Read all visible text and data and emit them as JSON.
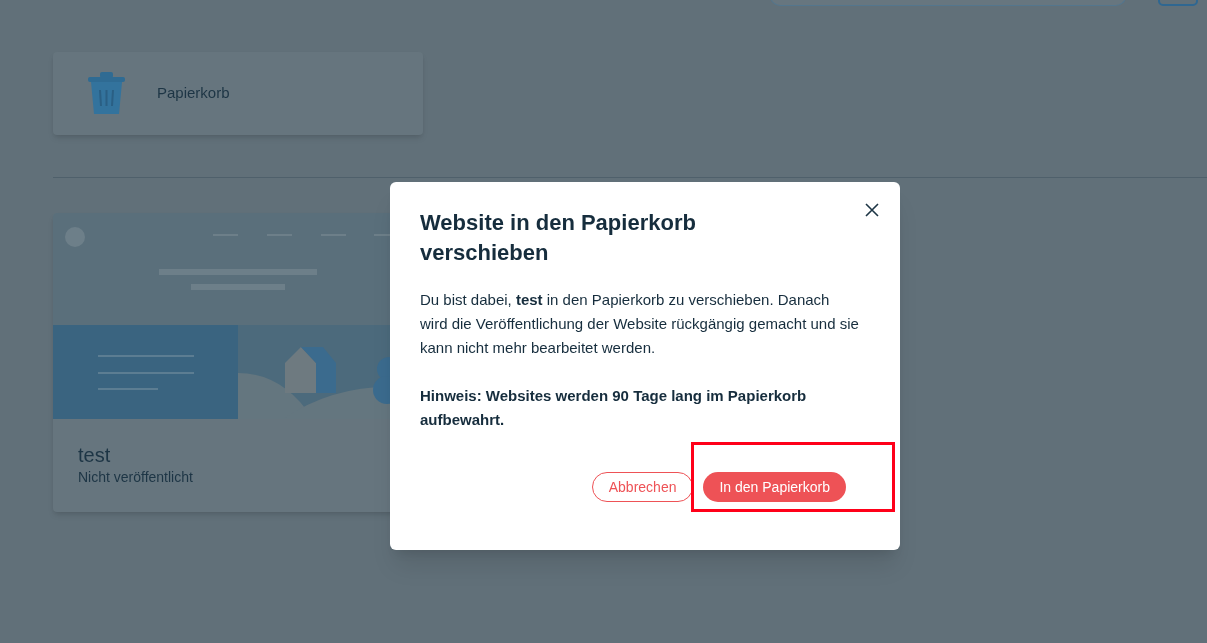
{
  "trash_card": {
    "label": "Papierkorb"
  },
  "site_card": {
    "name": "test",
    "status": "Nicht veröffentlicht"
  },
  "dialog": {
    "title": "Website in den Papierkorb verschieben",
    "message": "Du bist dabei, **test** in den Papierkorb zu verschieben. Danach wird die Veröffentlichung der Website rückgängig gemacht und sie kann nicht mehr bearbeitet werden.",
    "note": "Hinweis: Websites werden 90 Tage lang im Papierkorb aufbewahrt.",
    "buttons": [
      {
        "label": "Abbrechen",
        "kind": "secondary"
      },
      {
        "label": "In den Papierkorb",
        "kind": "primary"
      }
    ]
  }
}
